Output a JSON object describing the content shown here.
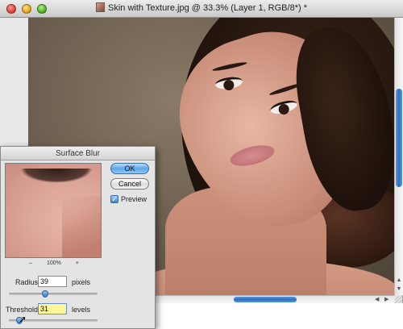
{
  "window": {
    "title": "Skin with Texture.jpg @ 33.3% (Layer 1, RGB/8*) *"
  },
  "dialog": {
    "title": "Surface Blur",
    "ok_label": "OK",
    "cancel_label": "Cancel",
    "preview_label": "Preview",
    "preview_checked": true,
    "zoom_out": "–",
    "zoom_level": "100%",
    "zoom_in": "+",
    "radius": {
      "label": "Radius:",
      "value": "39",
      "unit": "pixels",
      "slider_fraction": 0.41
    },
    "threshold": {
      "label": "Threshold:",
      "value": "31",
      "unit": "levels",
      "slider_fraction": 0.12
    }
  },
  "icons": {
    "close": "close-traffic-light",
    "minimize": "minimize-traffic-light",
    "zoom": "zoom-traffic-light",
    "document": "document-icon",
    "checkbox": "checkmark-icon",
    "cursor": "pointer-cursor-icon"
  },
  "colors": {
    "accent": "#3b87d4",
    "active_field": "#fff69a"
  }
}
